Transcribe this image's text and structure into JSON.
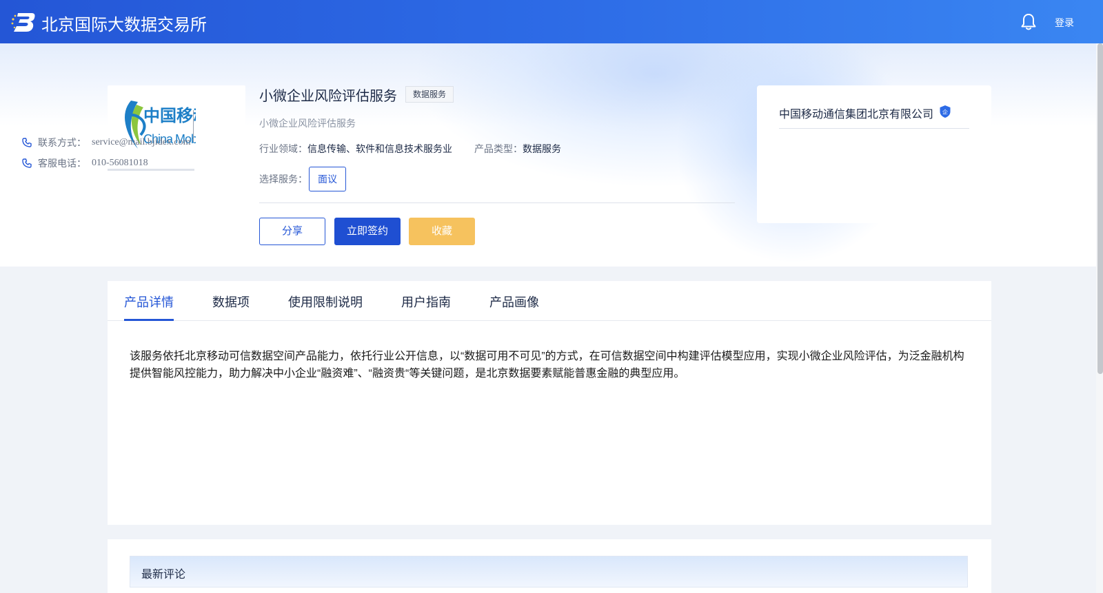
{
  "header": {
    "site_title": "北京国际大数据交易所",
    "login_label": "登录"
  },
  "product": {
    "title": "小微企业风险评估服务",
    "type_tag": "数据服务",
    "subtitle": "小微企业风险评估服务",
    "industry_label": "行业领域：",
    "industry_value": "信息传输、软件和信息技术服务业",
    "type_label": "产品类型：",
    "type_value": "数据服务",
    "service_label": "选择服务：",
    "service_option": "面议"
  },
  "actions": {
    "share": "分享",
    "sign": "立即签约",
    "favorite": "收藏"
  },
  "company": {
    "name": "中国移动通信集团北京有限公司",
    "contact_label": "联系方式：",
    "contact_value": "service@mail.bjidex.com",
    "phone_label": "客服电话：",
    "phone_value": "010-56081018"
  },
  "tabs": [
    {
      "label": "产品详情",
      "active": true
    },
    {
      "label": "数据项",
      "active": false
    },
    {
      "label": "使用限制说明",
      "active": false
    },
    {
      "label": "用户指南",
      "active": false
    },
    {
      "label": "产品画像",
      "active": false
    }
  ],
  "detail": {
    "description": "该服务依托北京移动可信数据空间产品能力，依托行业公开信息，以“数据可用不可见”的方式，在可信数据空间中构建评估模型应用，实现小微企业风险评估，为泛金融机构提供智能风控能力，助力解决中小企业“融资难”、“融资贵“等关键问题，是北京数据要素赋能普惠金融的典型应用。"
  },
  "comments": {
    "title": "最新评论"
  },
  "colors": {
    "brand_blue": "#2456d6",
    "favorite_yellow": "#f6c25e"
  },
  "icons": {
    "site_logo": "bidex-logo-icon",
    "notifications": "bell-icon",
    "verified": "shield-verified-icon",
    "phone": "phone-icon"
  }
}
